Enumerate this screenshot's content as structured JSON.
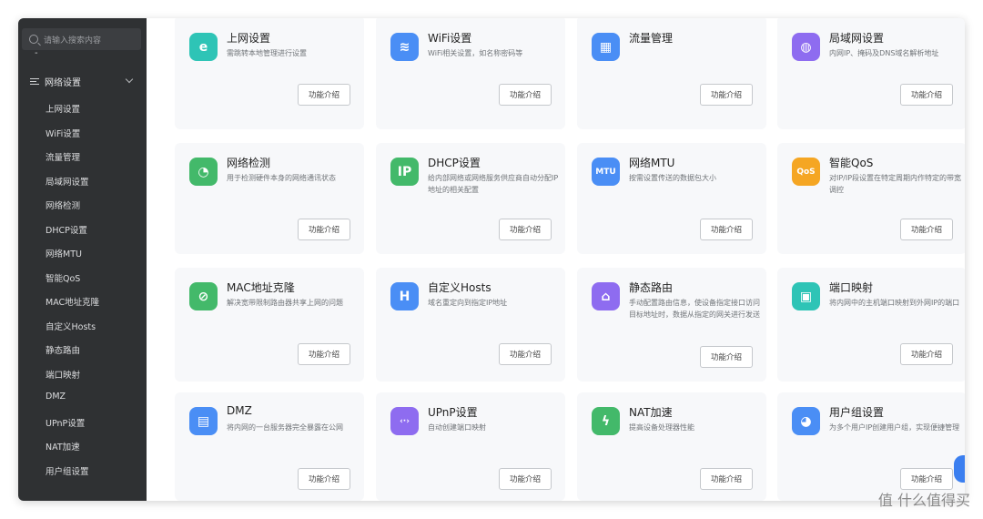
{
  "sidebar": {
    "search_placeholder": "请输入搜索内容",
    "dash": "-",
    "group_label": "网络设置",
    "items": [
      {
        "label": "上网设置"
      },
      {
        "label": "WiFi设置"
      },
      {
        "label": "流量管理"
      },
      {
        "label": "局域网设置"
      },
      {
        "label": "网络检测"
      },
      {
        "label": "DHCP设置"
      },
      {
        "label": "网络MTU"
      },
      {
        "label": "智能QoS"
      },
      {
        "label": "MAC地址克隆"
      },
      {
        "label": "自定义Hosts"
      },
      {
        "label": "静态路由"
      },
      {
        "label": "端口映射"
      },
      {
        "label": "DMZ"
      },
      {
        "label": "UPnP设置"
      },
      {
        "label": "NAT加速"
      },
      {
        "label": "用户组设置"
      }
    ]
  },
  "button_label": "功能介绍",
  "cards": [
    {
      "title": "上网设置",
      "desc": "需跳转本地管理进行设置",
      "icon": "e-icon",
      "glyph": "e",
      "color": "#2ec4b6"
    },
    {
      "title": "WiFi设置",
      "desc": "WiFi相关设置，如名称密码等",
      "icon": "wifi-icon",
      "glyph": "≋",
      "color": "#4a8ef5"
    },
    {
      "title": "流量管理",
      "desc": "",
      "icon": "grid-icon",
      "glyph": "▦",
      "color": "#4a8ef5"
    },
    {
      "title": "局域网设置",
      "desc": "内网IP、掩码及DNS域名解析地址",
      "icon": "globe-icon",
      "glyph": "◍",
      "color": "#8e6cf0"
    },
    {
      "title": "网络检测",
      "desc": "用于检测硬件本身的网络通讯状态",
      "icon": "monitor-icon",
      "glyph": "◔",
      "color": "#43b96a"
    },
    {
      "title": "DHCP设置",
      "desc": "给内部网络或网络服务供应商自动分配IP地址的相关配置",
      "icon": "ip-icon",
      "glyph": "IP",
      "color": "#43b96a"
    },
    {
      "title": "网络MTU",
      "desc": "按需设置传送的数据包大小",
      "icon": "mtu-icon",
      "glyph": "MTU",
      "color": "#4a8ef5"
    },
    {
      "title": "智能QoS",
      "desc": "对IP/IP段设置在特定周期内作特定的带宽调控",
      "icon": "qos-icon",
      "glyph": "QoS",
      "color": "#f5a623"
    },
    {
      "title": "MAC地址克隆",
      "desc": "解决宽带限制路由器共享上网的问题",
      "icon": "link-icon",
      "glyph": "⊘",
      "color": "#43b96a"
    },
    {
      "title": "自定义Hosts",
      "desc": "域名重定向到指定IP地址",
      "icon": "hosts-icon",
      "glyph": "H",
      "color": "#4a8ef5"
    },
    {
      "title": "静态路由",
      "desc": "手动配置路由信息，使设备指定接口访问目标地址时，数据从指定的网关进行发送",
      "icon": "route-icon",
      "glyph": "⌂",
      "color": "#8e6cf0"
    },
    {
      "title": "端口映射",
      "desc": "将内网中的主机端口映射到外网IP的端口",
      "icon": "port-icon",
      "glyph": "▣",
      "color": "#2ec4b6"
    },
    {
      "title": "DMZ",
      "desc": "将内网的一台服务器完全暴露在公网",
      "icon": "dmz-icon",
      "glyph": "▤",
      "color": "#4a8ef5"
    },
    {
      "title": "UPnP设置",
      "desc": "自动创建端口映射",
      "icon": "upnp-icon",
      "glyph": "‹·›",
      "color": "#8e6cf0"
    },
    {
      "title": "NAT加速",
      "desc": "提高设备处理器性能",
      "icon": "bolt-icon",
      "glyph": "ϟ",
      "color": "#43b96a"
    },
    {
      "title": "用户组设置",
      "desc": "为多个用户IP创建用户组，实现便捷管理",
      "icon": "users-icon",
      "glyph": "◕",
      "color": "#4a8ef5"
    }
  ],
  "watermark": "值 什么值得买"
}
